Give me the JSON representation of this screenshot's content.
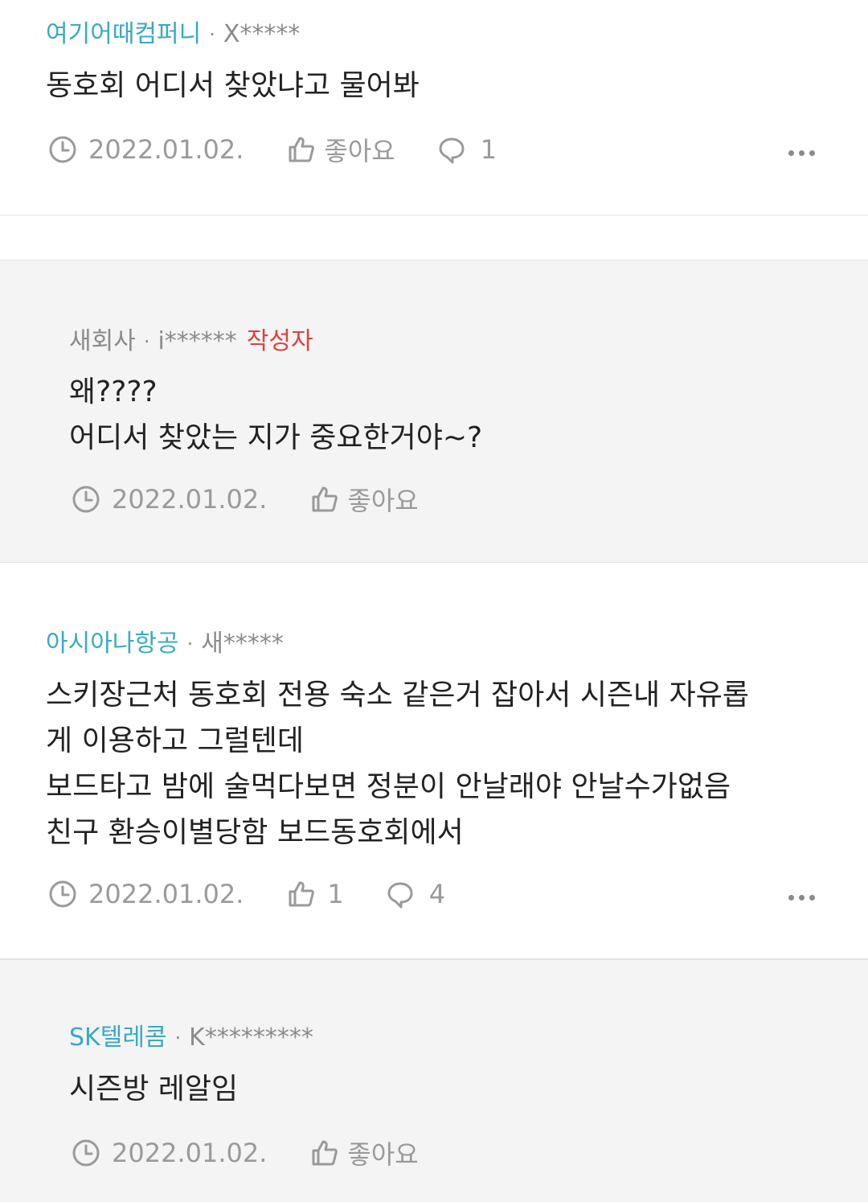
{
  "comments": [
    {
      "company": "여기어때컴퍼니",
      "separator": "·",
      "user": "X*****",
      "lines": [
        "동호회 어디서 찾았냐고 물어봐"
      ],
      "date": "2022.01.02.",
      "like_label": "좋아요",
      "reply_count": "1"
    },
    {
      "company": "새회사",
      "separator": "·",
      "user": "i******",
      "author_badge": "작성자",
      "lines": [
        "왜????",
        "어디서 찾았는 지가 중요한거야~?"
      ],
      "date": "2022.01.02.",
      "like_label": "좋아요"
    },
    {
      "company": "아시아나항공",
      "separator": "·",
      "user": "새*****",
      "lines": [
        "스키장근처 동호회 전용 숙소 같은거 잡아서 시즌내 자유롭",
        "게 이용하고 그럴텐데",
        "보드타고 밤에 술먹다보면 정분이 안날래야 안날수가없음",
        "친구 환승이별당함 보드동호회에서"
      ],
      "date": "2022.01.02.",
      "like_count": "1",
      "reply_count": "4"
    },
    {
      "company": "SK텔레콤",
      "separator": "·",
      "user": "K*********",
      "lines": [
        "시즌방 레알임"
      ],
      "date": "2022.01.02.",
      "like_label": "좋아요"
    }
  ],
  "colors": {
    "company_link": "#3aa9c2",
    "author_badge": "#e0413a",
    "meta_gray": "#9a9a9a",
    "reply_background": "#f4f4f4"
  },
  "icons": [
    "clock-icon",
    "thumbs-up-icon",
    "speech-bubble-icon",
    "more-dots-icon"
  ]
}
